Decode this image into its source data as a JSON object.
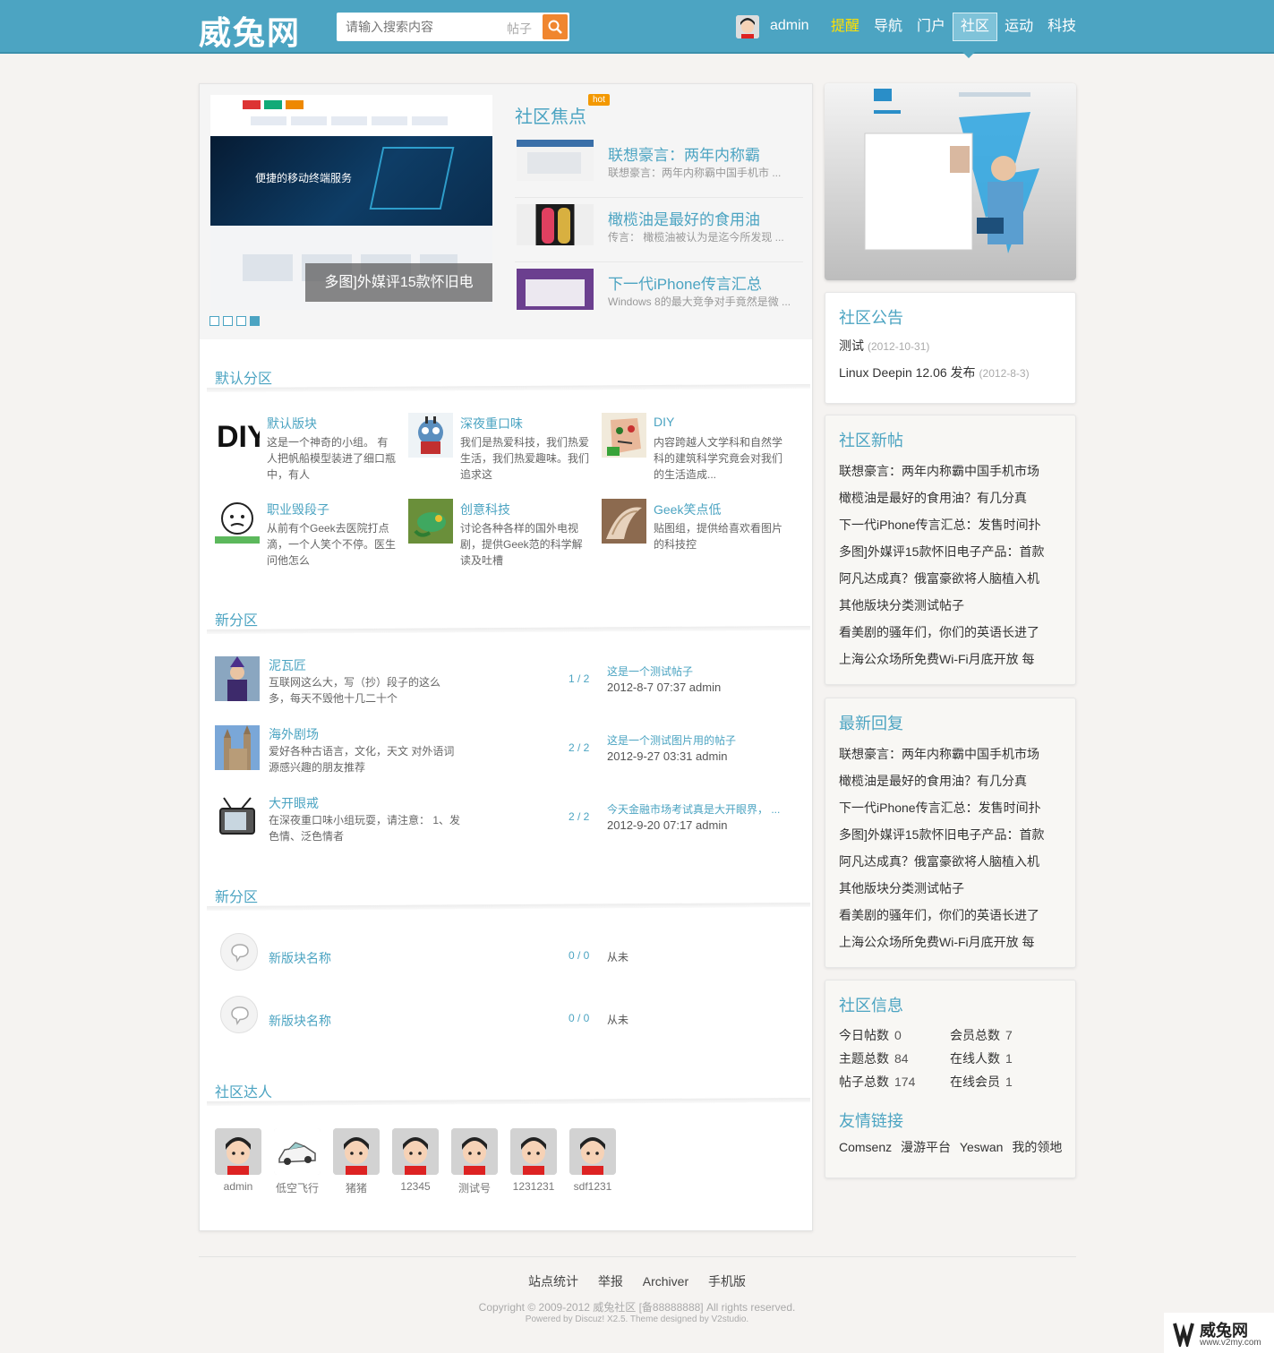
{
  "header": {
    "logo": "威兔网",
    "search_placeholder": "请输入搜索内容",
    "search_scope": "帖子",
    "username": "admin",
    "nav": [
      "提醒",
      "导航",
      "门户",
      "社区",
      "运动",
      "科技"
    ],
    "active_nav": "社区",
    "highlight_nav": "提醒",
    "accent_color": "#4ca4c2"
  },
  "focus": {
    "slide_caption": "多图]外媒评15款怀旧电",
    "slide_hero_text": "便捷的移动终端服务",
    "slide_count": 4,
    "active_slide": 4,
    "title": "社区焦点",
    "badge": "hot",
    "items": [
      {
        "title": "联想豪言：两年内称霸",
        "summary": "联想豪言：两年内称霸中国手机市 ..."
      },
      {
        "title": "橄榄油是最好的食用油",
        "summary": "传言： 橄榄油被认为是迄今所发现 ..."
      },
      {
        "title": "下一代iPhone传言汇总",
        "summary": "Windows 8的最大竞争对手竟然是微 ..."
      }
    ]
  },
  "sections": {
    "default_zone": "默认分区",
    "new_zone_1": "新分区",
    "new_zone_2": "新分区",
    "experts": "社区达人"
  },
  "forums_grid": [
    {
      "name": "默认版块",
      "desc": "这是一个神奇的小组。 有人把帆船模型装进了细口瓶中，有人"
    },
    {
      "name": "深夜重口味",
      "desc": "我们是热爱科技，我们热爱生活，我们热爱趣味。我们追求这"
    },
    {
      "name": "DIY",
      "desc": "内容跨越人文学科和自然学科的建筑科学究竟会对我们的生活造成..."
    },
    {
      "name": "职业毁段子",
      "desc": "从前有个Geek去医院打点滴，一个人笑个不停。医生问他怎么"
    },
    {
      "name": "创意科技",
      "desc": "讨论各种各样的国外电视剧，提供Geek范的科学解读及吐槽"
    },
    {
      "name": "Geek笑点低",
      "desc": "贴图组，提供给喜欢看图片的科技控"
    }
  ],
  "forums_list": [
    {
      "name": "泥瓦匠",
      "desc": "互联网这么大，写（抄）段子的这么多，每天不毁他十几二十个",
      "count": "1 / 2",
      "last_title": "这是一个测试帖子",
      "last_time": "2012-8-7 07:37 admin"
    },
    {
      "name": "海外剧场",
      "desc": "爱好各种古语言，文化，天文 对外语词源感兴趣的朋友推荐",
      "count": "2 / 2",
      "last_title": "这是一个测试图片用的帖子",
      "last_time": "2012-9-27 03:31 admin"
    },
    {
      "name": "大开眼戒",
      "desc": "在深夜重口味小组玩耍，请注意： 1、发色情、泛色情者",
      "count": "2 / 2",
      "last_title": "今天金融市场考试真是大开眼界， ...",
      "last_time": "2012-9-20 07:17 admin"
    }
  ],
  "forums_new": [
    {
      "name": "新版块名称",
      "count": "0 / 0",
      "last": "从未"
    },
    {
      "name": "新版块名称",
      "count": "0 / 0",
      "last": "从未"
    }
  ],
  "experts": [
    "admin",
    "低空飞行",
    "猪猪",
    "12345",
    "测试号",
    "1231231",
    "sdf1231"
  ],
  "sidebar": {
    "notice_title": "社区公告",
    "notices": [
      {
        "text": "测试",
        "date": "(2012-10-31)"
      },
      {
        "text": "Linux Deepin 12.06 发布",
        "date": "(2012-8-3)"
      }
    ],
    "new_posts_title": "社区新帖",
    "new_posts": [
      "联想豪言：两年内称霸中国手机市场",
      "橄榄油是最好的食用油？有几分真",
      "下一代iPhone传言汇总：发售时间扑",
      "多图]外媒评15款怀旧电子产品：首款",
      "阿凡达成真？俄富豪欲将人脑植入机",
      "其他版块分类测试帖子",
      "看美剧的骚年们，你们的英语长进了",
      "上海公众场所免费Wi-Fi月底开放 每"
    ],
    "replies_title": "最新回复",
    "replies": [
      "联想豪言：两年内称霸中国手机市场",
      "橄榄油是最好的食用油？有几分真",
      "下一代iPhone传言汇总：发售时间扑",
      "多图]外媒评15款怀旧电子产品：首款",
      "阿凡达成真？俄富豪欲将人脑植入机",
      "其他版块分类测试帖子",
      "看美剧的骚年们，你们的英语长进了",
      "上海公众场所免费Wi-Fi月底开放 每"
    ],
    "info_title": "社区信息",
    "stats": [
      {
        "label": "今日帖数",
        "value": "0"
      },
      {
        "label": "会员总数",
        "value": "7"
      },
      {
        "label": "主题总数",
        "value": "84"
      },
      {
        "label": "在线人数",
        "value": "1"
      },
      {
        "label": "帖子总数",
        "value": "174"
      },
      {
        "label": "在线会员",
        "value": "1"
      }
    ],
    "links_title": "友情链接",
    "links": [
      "Comsenz",
      "漫游平台",
      "Yeswan",
      "我的领地"
    ]
  },
  "footer": {
    "nav": [
      "站点统计",
      "举报",
      "Archiver",
      "手机版"
    ],
    "copyright": "Copyright © 2009-2012 威兔社区 [备88888888] All rights reserved.",
    "powered": "Powered by Discuz! X2.5. Theme designed by V2studio.",
    "watermark": "威兔网",
    "watermark_url": "www.v2my.com"
  }
}
